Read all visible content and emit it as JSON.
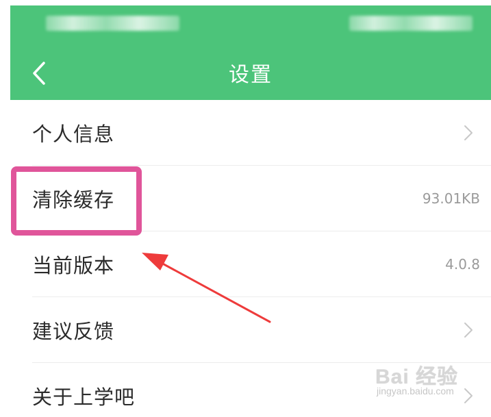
{
  "header": {
    "title": "设置",
    "back_icon": "chevron-left-icon"
  },
  "settings": {
    "items": [
      {
        "label": "个人信息",
        "value": "",
        "chevron": true
      },
      {
        "label": "清除缓存",
        "value": "93.01KB",
        "chevron": false
      },
      {
        "label": "当前版本",
        "value": "4.0.8",
        "chevron": false
      },
      {
        "label": "建议反馈",
        "value": "",
        "chevron": true
      },
      {
        "label": "关于上学吧",
        "value": "",
        "chevron": true
      }
    ]
  },
  "watermark": {
    "logo": "Bai 经验",
    "url": "jingyan.baidu.com"
  },
  "colors": {
    "header": "#4cc47a",
    "highlight": "#e0559a",
    "arrow": "#ee3b3b"
  }
}
